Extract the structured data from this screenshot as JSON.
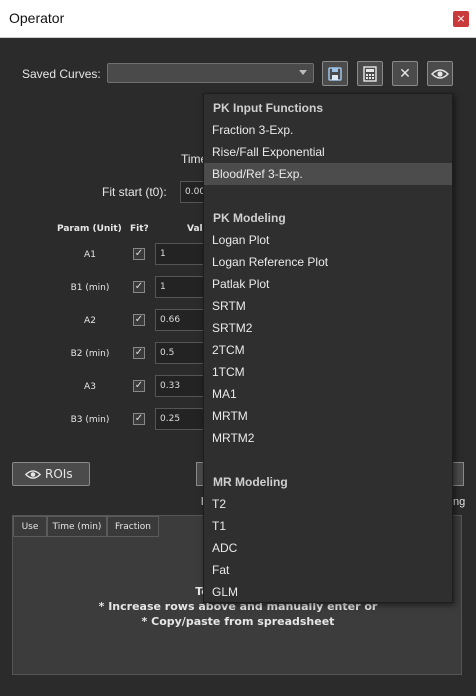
{
  "window": {
    "title": "Operator",
    "close_glyph": "×"
  },
  "saved_curves": {
    "label": "Saved Curves:",
    "value": ""
  },
  "toolbar": {
    "icons": [
      "save-icon",
      "calculator-icon",
      "close-icon",
      "eye-icon"
    ],
    "close_glyph": "✕"
  },
  "fit": {
    "time_label": "Time",
    "fit_start_label": "Fit start (t0):",
    "fit_start_value": "0.00"
  },
  "params": {
    "headers": {
      "param": "Param (Unit)",
      "fit": "Fit?",
      "value": "Valu"
    },
    "rows": [
      {
        "name": "A1",
        "fit": true,
        "value": "1"
      },
      {
        "name": "B1 (min)",
        "fit": true,
        "value": "1"
      },
      {
        "name": "A2",
        "fit": true,
        "value": "0.66"
      },
      {
        "name": "B2 (min)",
        "fit": true,
        "value": "0.5"
      },
      {
        "name": "A3",
        "fit": true,
        "value": "0.33"
      },
      {
        "name": "B3 (min)",
        "fit": true,
        "value": "0.25"
      }
    ]
  },
  "rois_button": {
    "label": "ROIs"
  },
  "partial": {
    "right_l": "l",
    "right_ng": "ng"
  },
  "data_table": {
    "columns": [
      "Use",
      "Time (min)",
      "Fraction"
    ],
    "placeholder": [
      "To add Parent",
      "* Increase rows above and manually enter or",
      "* Copy/paste from spreadsheet"
    ]
  },
  "dropdown": {
    "sections": [
      {
        "title": "PK Input Functions",
        "items": [
          "Fraction 3-Exp.",
          "Rise/Fall Exponential",
          "Blood/Ref 3-Exp."
        ]
      },
      {
        "title": "PK Modeling",
        "items": [
          "Logan Plot",
          "Logan Reference Plot",
          "Patlak Plot",
          "SRTM",
          "SRTM2",
          "2TCM",
          "1TCM",
          "MA1",
          "MRTM",
          "MRTM2"
        ]
      },
      {
        "title": "MR Modeling",
        "items": [
          "T2",
          "T1",
          "ADC",
          "Fat",
          "GLM"
        ]
      }
    ],
    "highlighted": "Blood/Ref 3-Exp."
  }
}
